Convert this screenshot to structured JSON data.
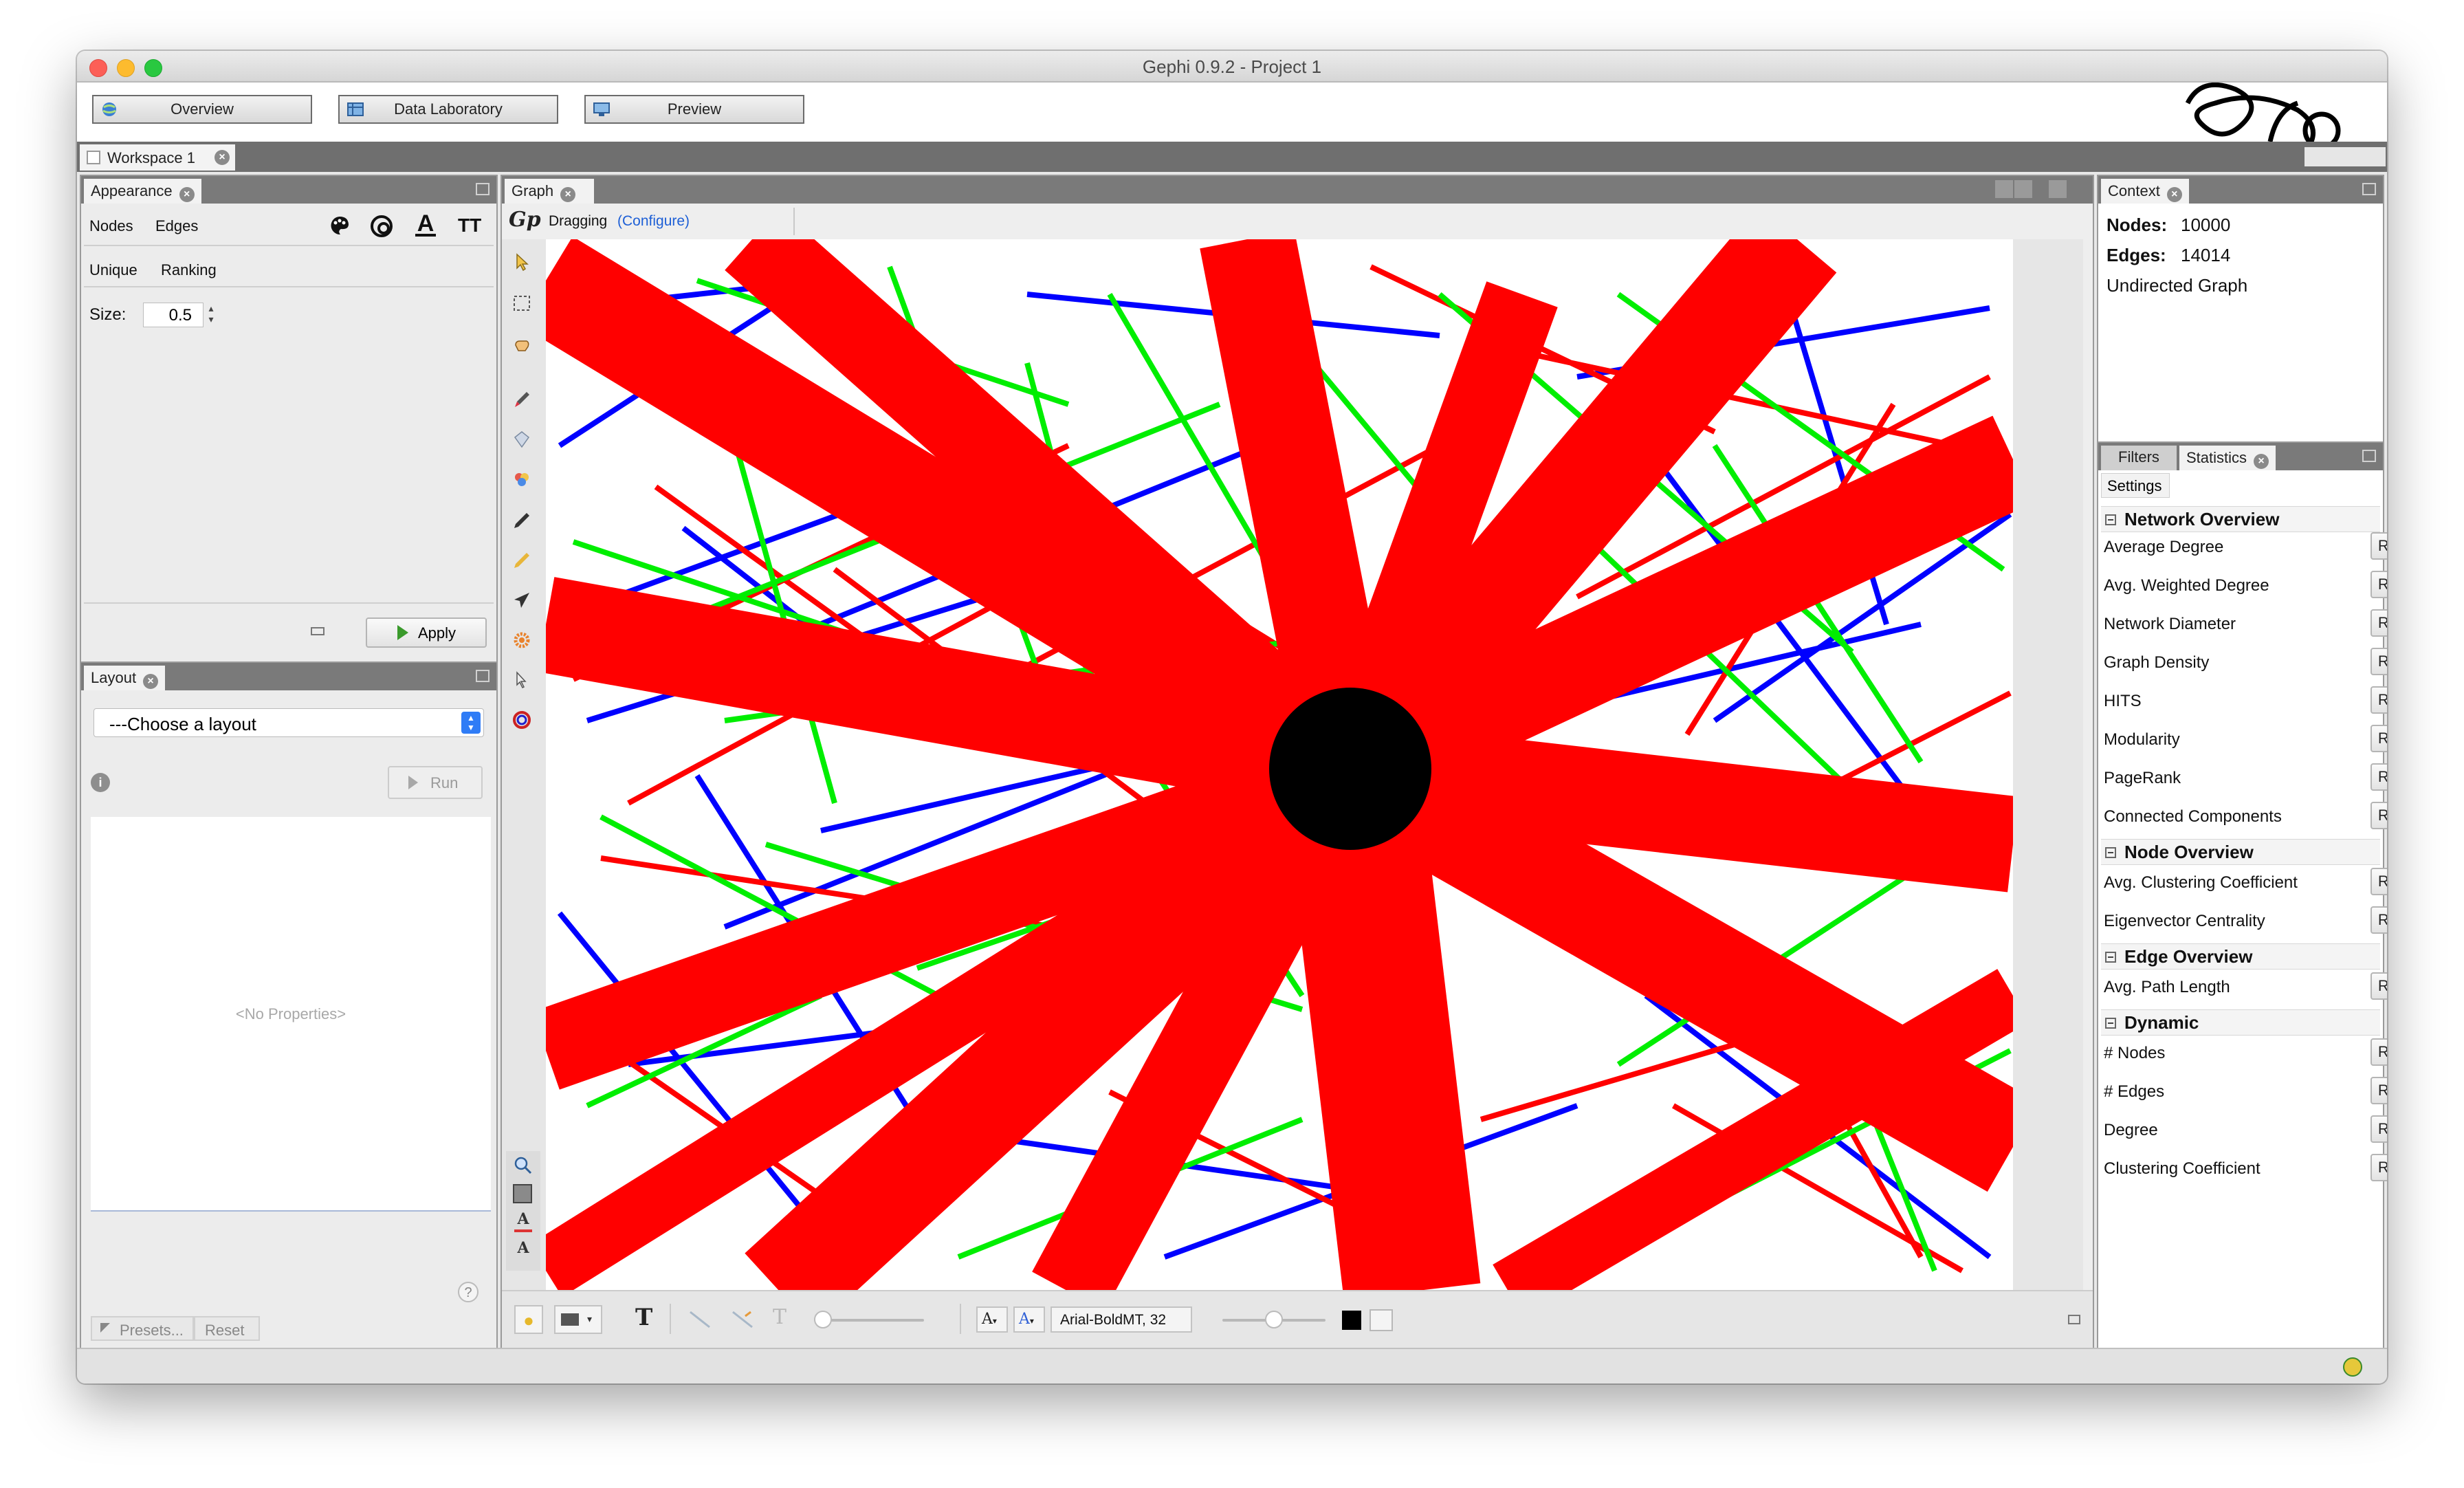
{
  "window": {
    "title": "Gephi 0.9.2 - Project 1"
  },
  "colors": {
    "edge_red": "#ff0000",
    "edge_green": "#00ee00",
    "edge_blue": "#0000ff",
    "node": "#000000",
    "canvas_bg": "#ffffff"
  },
  "toolbar": {
    "overview": "Overview",
    "data_laboratory": "Data Laboratory",
    "preview": "Preview"
  },
  "workspace": {
    "tab": "Workspace 1"
  },
  "appearance": {
    "tab": "Appearance",
    "nodes": "Nodes",
    "edges": "Edges",
    "unique": "Unique",
    "ranking": "Ranking",
    "size_label": "Size:",
    "size_value": "0.5",
    "text_size_glyph": "TT",
    "text_color_glyph": "A",
    "apply": "Apply"
  },
  "layout": {
    "tab": "Layout",
    "choose": "---Choose a layout",
    "run": "Run",
    "no_properties": "<No Properties>",
    "help": "?",
    "presets": "Presets...",
    "reset": "Reset"
  },
  "graph": {
    "tab": "Graph",
    "mode": "Dragging",
    "configure": "(Configure)",
    "bottom_text_glyph": "T",
    "font_a_glyph": "A",
    "font_name": "Arial-BoldMT, 32"
  },
  "context": {
    "tab": "Context",
    "nodes_label": "Nodes:",
    "nodes_value": "10000",
    "edges_label": "Edges:",
    "edges_value": "14014",
    "graph_type": "Undirected Graph"
  },
  "statistics": {
    "filters_tab": "Filters",
    "statistics_tab": "Statistics",
    "settings": "Settings",
    "run_label": "Run",
    "sections": [
      {
        "title": "Network Overview",
        "items": [
          "Average Degree",
          "Avg. Weighted Degree",
          "Network Diameter",
          "Graph Density",
          "HITS",
          "Modularity",
          "PageRank",
          "Connected Components"
        ]
      },
      {
        "title": "Node Overview",
        "items": [
          "Avg. Clustering Coefficient",
          "Eigenvector Centrality"
        ]
      },
      {
        "title": "Edge Overview",
        "items": [
          "Avg. Path Length"
        ]
      },
      {
        "title": "Dynamic",
        "items": [
          "# Nodes",
          "# Edges",
          "Degree",
          "Clustering Coefficient"
        ]
      }
    ]
  }
}
